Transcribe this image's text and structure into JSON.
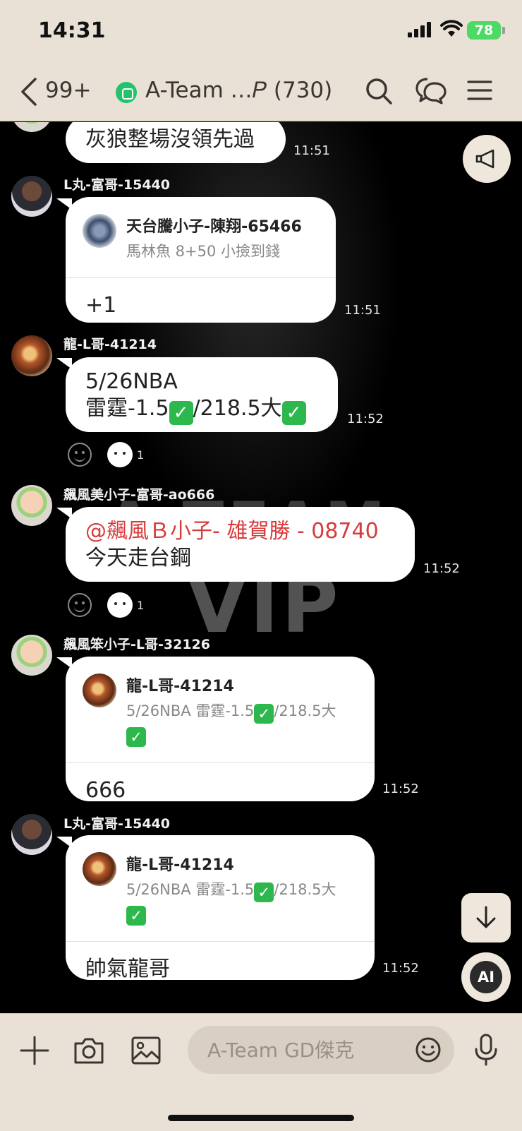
{
  "status_bar": {
    "time": "14:31",
    "battery": "78"
  },
  "header": {
    "back_count": "99+",
    "title": "A-Team …𝑃 (730)"
  },
  "messages": [
    {
      "text": "灰狼整場沒領先過",
      "time": "11:51"
    },
    {
      "sender": "L丸-富哥-15440",
      "reply_name": "天台騰小子-陳翔-65466",
      "reply_snippet": "馬林魚 8+50 小撿到錢",
      "text": "+1",
      "time": "11:51"
    },
    {
      "sender": "龍-L哥-41214",
      "line1": "5/26NBA",
      "line2a": "雷霆-1.5",
      "line2b": "/218.5大",
      "time": "11:52",
      "reaction_count": "1"
    },
    {
      "sender": "飆風美小子-富哥-ao666",
      "mention": "@飆風Ｂ小子- 雄賀勝 - 08740",
      "text": "今天走台鋼",
      "time": "11:52",
      "reaction_count": "1"
    },
    {
      "sender": "飆風笨小子-L哥-32126",
      "reply_name": "龍-L哥-41214",
      "reply_a": "5/26NBA 雷霆-1.5",
      "reply_b": "/218.5大",
      "text": "666",
      "time": "11:52"
    },
    {
      "sender": "L丸-富哥-15440",
      "reply_name": "龍-L哥-41214",
      "reply_a": "5/26NBA 雷霆-1.5",
      "reply_b": "/218.5大",
      "text": "帥氣龍哥",
      "time": "11:52"
    }
  ],
  "watermark": {
    "line1": "A TEAM",
    "line2": "VIP"
  },
  "ai_button_label": "AI",
  "input": {
    "placeholder": "A-Team GD傑克"
  },
  "icons": [
    "back-chevron",
    "search",
    "chat-bubbles",
    "menu",
    "megaphone",
    "arrow-down",
    "plus",
    "camera",
    "image",
    "emoji",
    "microphone"
  ],
  "colors": {
    "bar_bg": "#e9e1d6",
    "mention": "#d83b3b",
    "check": "#2db84d",
    "online": "#25c26e"
  }
}
